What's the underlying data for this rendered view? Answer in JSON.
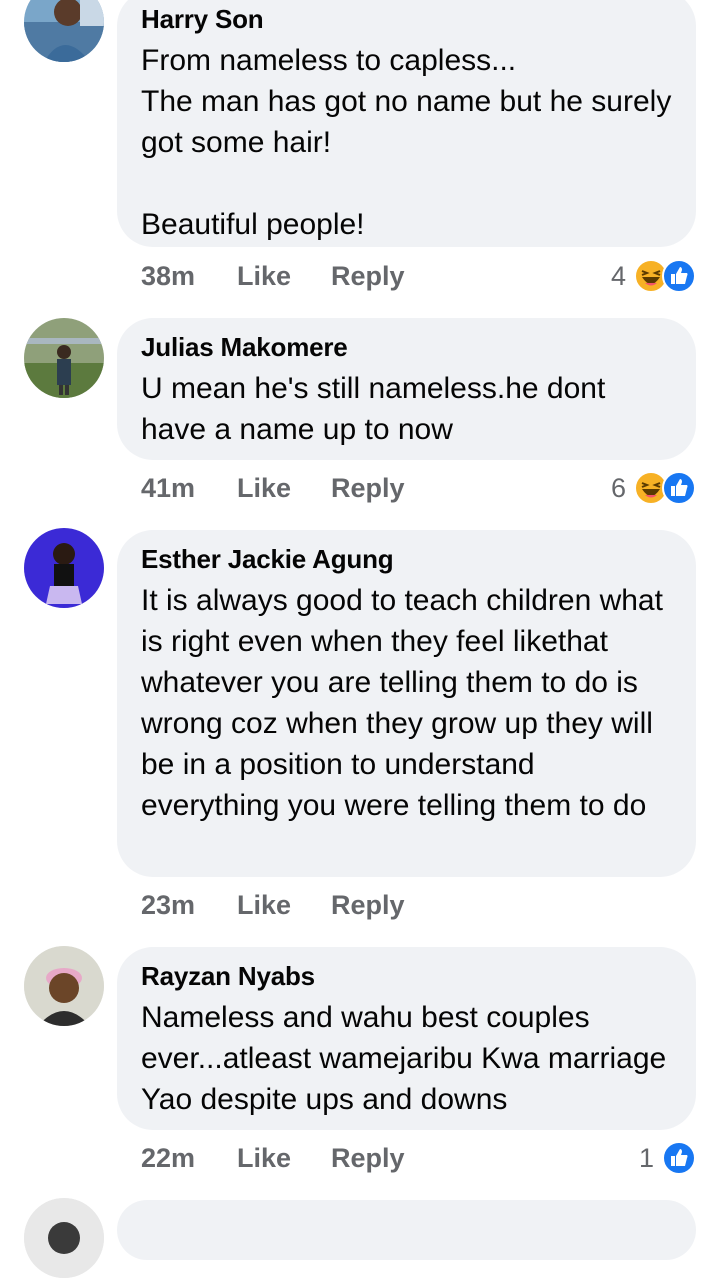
{
  "comments": [
    {
      "author": "Harry Son",
      "text": "From nameless to capless...\nThe man has got no name but he surely got some hair!\n\nBeautiful people!",
      "time": "38m",
      "like_label": "Like",
      "reply_label": "Reply",
      "reaction_count": "4",
      "reactions": [
        "haha-icon",
        "like-icon"
      ]
    },
    {
      "author": "Julias Makomere",
      "text": "U mean he's still nameless.he dont have a name up to now",
      "time": "41m",
      "like_label": "Like",
      "reply_label": "Reply",
      "reaction_count": "6",
      "reactions": [
        "haha-icon",
        "like-icon"
      ]
    },
    {
      "author": "Esther Jackie Agung",
      "text": "It is always good to teach children what is right even when they feel likethat whatever you are telling them to do is wrong coz when they grow up they will be in a position to understand everything you were telling them to do",
      "time": "23m",
      "like_label": "Like",
      "reply_label": "Reply",
      "reaction_count": "",
      "reactions": []
    },
    {
      "author": "Rayzan Nyabs",
      "text": "Nameless and wahu best couples ever...atleast wamejaribu Kwa marriage Yao despite ups and downs",
      "time": "22m",
      "like_label": "Like",
      "reply_label": "Reply",
      "reaction_count": "1",
      "reactions": [
        "like-icon"
      ]
    }
  ],
  "colors": {
    "bubble": "#f0f2f5",
    "meta_text": "#65676b",
    "like_blue": "#1877f2",
    "haha_yellow": "#f7b125"
  }
}
